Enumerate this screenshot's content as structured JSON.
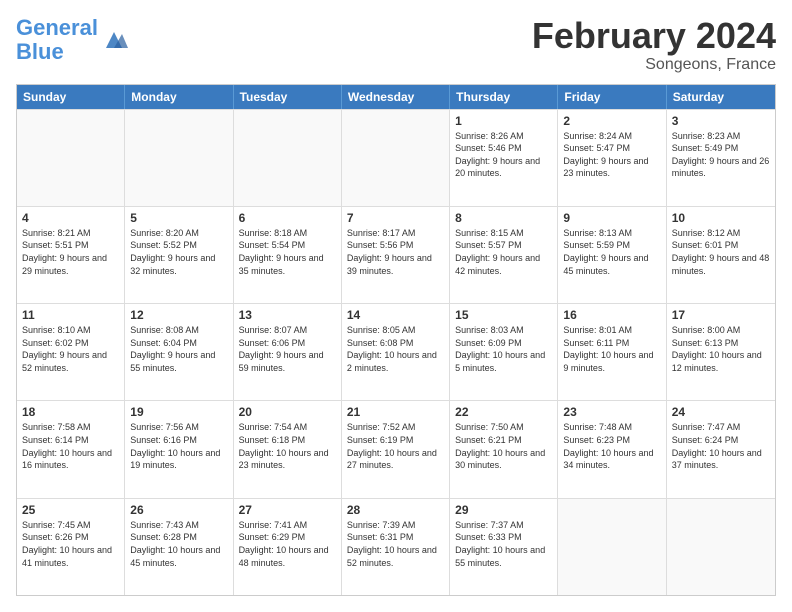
{
  "logo": {
    "line1": "General",
    "line2": "Blue"
  },
  "title": "February 2024",
  "subtitle": "Songeons, France",
  "header_days": [
    "Sunday",
    "Monday",
    "Tuesday",
    "Wednesday",
    "Thursday",
    "Friday",
    "Saturday"
  ],
  "weeks": [
    [
      {
        "day": "",
        "info": "",
        "empty": true
      },
      {
        "day": "",
        "info": "",
        "empty": true
      },
      {
        "day": "",
        "info": "",
        "empty": true
      },
      {
        "day": "",
        "info": "",
        "empty": true
      },
      {
        "day": "1",
        "info": "Sunrise: 8:26 AM\nSunset: 5:46 PM\nDaylight: 9 hours\nand 20 minutes."
      },
      {
        "day": "2",
        "info": "Sunrise: 8:24 AM\nSunset: 5:47 PM\nDaylight: 9 hours\nand 23 minutes."
      },
      {
        "day": "3",
        "info": "Sunrise: 8:23 AM\nSunset: 5:49 PM\nDaylight: 9 hours\nand 26 minutes."
      }
    ],
    [
      {
        "day": "4",
        "info": "Sunrise: 8:21 AM\nSunset: 5:51 PM\nDaylight: 9 hours\nand 29 minutes."
      },
      {
        "day": "5",
        "info": "Sunrise: 8:20 AM\nSunset: 5:52 PM\nDaylight: 9 hours\nand 32 minutes."
      },
      {
        "day": "6",
        "info": "Sunrise: 8:18 AM\nSunset: 5:54 PM\nDaylight: 9 hours\nand 35 minutes."
      },
      {
        "day": "7",
        "info": "Sunrise: 8:17 AM\nSunset: 5:56 PM\nDaylight: 9 hours\nand 39 minutes."
      },
      {
        "day": "8",
        "info": "Sunrise: 8:15 AM\nSunset: 5:57 PM\nDaylight: 9 hours\nand 42 minutes."
      },
      {
        "day": "9",
        "info": "Sunrise: 8:13 AM\nSunset: 5:59 PM\nDaylight: 9 hours\nand 45 minutes."
      },
      {
        "day": "10",
        "info": "Sunrise: 8:12 AM\nSunset: 6:01 PM\nDaylight: 9 hours\nand 48 minutes."
      }
    ],
    [
      {
        "day": "11",
        "info": "Sunrise: 8:10 AM\nSunset: 6:02 PM\nDaylight: 9 hours\nand 52 minutes."
      },
      {
        "day": "12",
        "info": "Sunrise: 8:08 AM\nSunset: 6:04 PM\nDaylight: 9 hours\nand 55 minutes."
      },
      {
        "day": "13",
        "info": "Sunrise: 8:07 AM\nSunset: 6:06 PM\nDaylight: 9 hours\nand 59 minutes."
      },
      {
        "day": "14",
        "info": "Sunrise: 8:05 AM\nSunset: 6:08 PM\nDaylight: 10 hours\nand 2 minutes."
      },
      {
        "day": "15",
        "info": "Sunrise: 8:03 AM\nSunset: 6:09 PM\nDaylight: 10 hours\nand 5 minutes."
      },
      {
        "day": "16",
        "info": "Sunrise: 8:01 AM\nSunset: 6:11 PM\nDaylight: 10 hours\nand 9 minutes."
      },
      {
        "day": "17",
        "info": "Sunrise: 8:00 AM\nSunset: 6:13 PM\nDaylight: 10 hours\nand 12 minutes."
      }
    ],
    [
      {
        "day": "18",
        "info": "Sunrise: 7:58 AM\nSunset: 6:14 PM\nDaylight: 10 hours\nand 16 minutes."
      },
      {
        "day": "19",
        "info": "Sunrise: 7:56 AM\nSunset: 6:16 PM\nDaylight: 10 hours\nand 19 minutes."
      },
      {
        "day": "20",
        "info": "Sunrise: 7:54 AM\nSunset: 6:18 PM\nDaylight: 10 hours\nand 23 minutes."
      },
      {
        "day": "21",
        "info": "Sunrise: 7:52 AM\nSunset: 6:19 PM\nDaylight: 10 hours\nand 27 minutes."
      },
      {
        "day": "22",
        "info": "Sunrise: 7:50 AM\nSunset: 6:21 PM\nDaylight: 10 hours\nand 30 minutes."
      },
      {
        "day": "23",
        "info": "Sunrise: 7:48 AM\nSunset: 6:23 PM\nDaylight: 10 hours\nand 34 minutes."
      },
      {
        "day": "24",
        "info": "Sunrise: 7:47 AM\nSunset: 6:24 PM\nDaylight: 10 hours\nand 37 minutes."
      }
    ],
    [
      {
        "day": "25",
        "info": "Sunrise: 7:45 AM\nSunset: 6:26 PM\nDaylight: 10 hours\nand 41 minutes."
      },
      {
        "day": "26",
        "info": "Sunrise: 7:43 AM\nSunset: 6:28 PM\nDaylight: 10 hours\nand 45 minutes."
      },
      {
        "day": "27",
        "info": "Sunrise: 7:41 AM\nSunset: 6:29 PM\nDaylight: 10 hours\nand 48 minutes."
      },
      {
        "day": "28",
        "info": "Sunrise: 7:39 AM\nSunset: 6:31 PM\nDaylight: 10 hours\nand 52 minutes."
      },
      {
        "day": "29",
        "info": "Sunrise: 7:37 AM\nSunset: 6:33 PM\nDaylight: 10 hours\nand 55 minutes."
      },
      {
        "day": "",
        "info": "",
        "empty": true
      },
      {
        "day": "",
        "info": "",
        "empty": true
      }
    ]
  ]
}
